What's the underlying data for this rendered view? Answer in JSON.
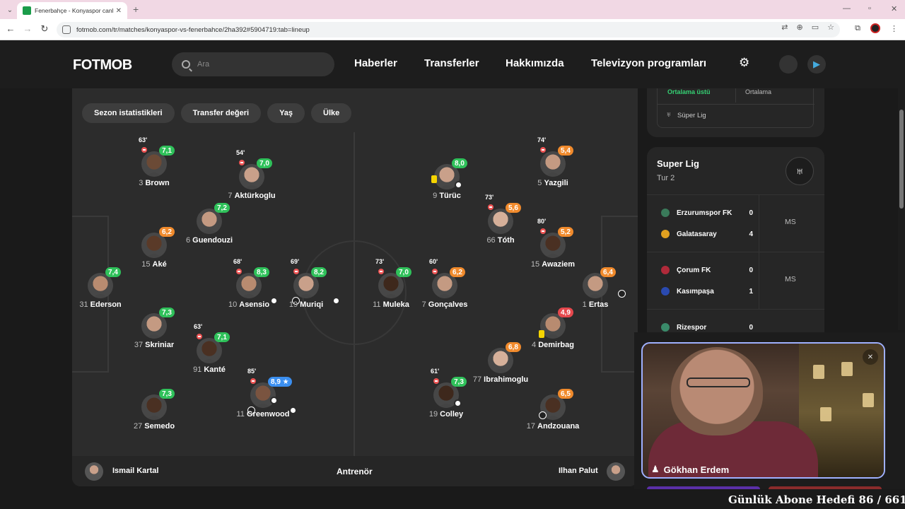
{
  "browser": {
    "tab_title": "Fenerbahçe - Konyaspor canlı s",
    "url": "fotmob.com/tr/matches/konyaspor-vs-fenerbahce/2ha392#5904719:tab=lineup"
  },
  "header": {
    "logo": "FOTMOB",
    "search_placeholder": "Ara",
    "nav": [
      "Haberler",
      "Transferler",
      "Hakkımızda",
      "Televizyon programları"
    ]
  },
  "filters": [
    "Sezon istatistikleri",
    "Transfer değeri",
    "Yaş",
    "Ülke"
  ],
  "rating_colors": {
    "green": "#2fc15a",
    "orange": "#f08a2c",
    "red": "#e5484d",
    "blue": "#3b8ff0"
  },
  "players": [
    {
      "num": "3",
      "name": "Brown",
      "rating": "7,1",
      "color": "green",
      "sub": "63'",
      "skin": "#6b4a36"
    },
    {
      "num": "7",
      "name": "Aktürkoglu",
      "rating": "7,0",
      "color": "green",
      "sub": "54'",
      "skin": "#c9a08a"
    },
    {
      "num": "6",
      "name": "Guendouzi",
      "rating": "7,2",
      "color": "green",
      "sub": "",
      "skin": "#c49a82"
    },
    {
      "num": "15",
      "name": "Aké",
      "rating": "6,2",
      "color": "orange",
      "sub": "",
      "skin": "#5a3a28"
    },
    {
      "num": "31",
      "name": "Ederson",
      "rating": "7,4",
      "color": "green",
      "sub": "",
      "skin": "#b88b70"
    },
    {
      "num": "10",
      "name": "Asensio",
      "rating": "8,3",
      "color": "green",
      "sub": "68'",
      "skin": "#b88b70"
    },
    {
      "num": "19",
      "name": "Muriqi",
      "rating": "8,2",
      "color": "green",
      "sub": "69'",
      "skin": "#c9a08a"
    },
    {
      "num": "37",
      "name": "Skriniar",
      "rating": "7,3",
      "color": "green",
      "sub": "",
      "skin": "#c49a82"
    },
    {
      "num": "91",
      "name": "Kanté",
      "rating": "7,1",
      "color": "green",
      "sub": "63'",
      "skin": "#4a3022"
    },
    {
      "num": "11",
      "name": "Greenwood",
      "rating": "8,9 ★",
      "color": "blue",
      "sub": "85'",
      "skin": "#7a5440"
    },
    {
      "num": "27",
      "name": "Semedo",
      "rating": "7,3",
      "color": "green",
      "sub": "",
      "skin": "#4a3022"
    },
    {
      "num": "9",
      "name": "Türüc",
      "rating": "8,0",
      "color": "green",
      "sub": "",
      "skin": "#c9a08a"
    },
    {
      "num": "5",
      "name": "Yazgili",
      "rating": "5,4",
      "color": "orange",
      "sub": "74'",
      "skin": "#c49a82"
    },
    {
      "num": "66",
      "name": "Tóth",
      "rating": "5,6",
      "color": "orange",
      "sub": "73'",
      "skin": "#d6b09a"
    },
    {
      "num": "15",
      "name": "Awaziem",
      "rating": "5,2",
      "color": "orange",
      "sub": "80'",
      "skin": "#4a3022"
    },
    {
      "num": "11",
      "name": "Muleka",
      "rating": "7,0",
      "color": "green",
      "sub": "73'",
      "skin": "#3e281c"
    },
    {
      "num": "7",
      "name": "Gonçalves",
      "rating": "6,2",
      "color": "orange",
      "sub": "60'",
      "skin": "#c49a82"
    },
    {
      "num": "1",
      "name": "Ertas",
      "rating": "6,4",
      "color": "orange",
      "sub": "",
      "skin": "#c49a82"
    },
    {
      "num": "4",
      "name": "Demirbag",
      "rating": "4,9",
      "color": "red",
      "sub": "",
      "skin": "#b88b70"
    },
    {
      "num": "77",
      "name": "Ibrahimoglu",
      "rating": "6,8",
      "color": "orange",
      "sub": "",
      "skin": "#d6b09a"
    },
    {
      "num": "19",
      "name": "Colley",
      "rating": "7,3",
      "color": "green",
      "sub": "61'",
      "skin": "#3e281c"
    },
    {
      "num": "17",
      "name": "Andzouana",
      "rating": "6,5",
      "color": "orange",
      "sub": "",
      "skin": "#4a3022"
    }
  ],
  "coaches": {
    "home": "Ismail Kartal",
    "title": "Antrenör",
    "away": "Ilhan Palut"
  },
  "side_top": {
    "above_avg": "Ortalama üstü",
    "avg": "Ortalama",
    "league": "Süper Lig"
  },
  "league_card": {
    "title": "Super Lig",
    "round": "Tur 2",
    "matches": [
      {
        "home": "Erzurumspor FK",
        "home_score": "0",
        "away": "Galatasaray",
        "away_score": "4",
        "status": "MS"
      },
      {
        "home": "Çorum FK",
        "home_score": "0",
        "away": "Kasımpaşa",
        "away_score": "1",
        "status": "MS"
      },
      {
        "home": "Rizespor",
        "home_score": "0"
      }
    ]
  },
  "webcam": {
    "name": "Gökhan Erdem"
  },
  "banner": "Günlük Abone Hedefi 86 / 661"
}
